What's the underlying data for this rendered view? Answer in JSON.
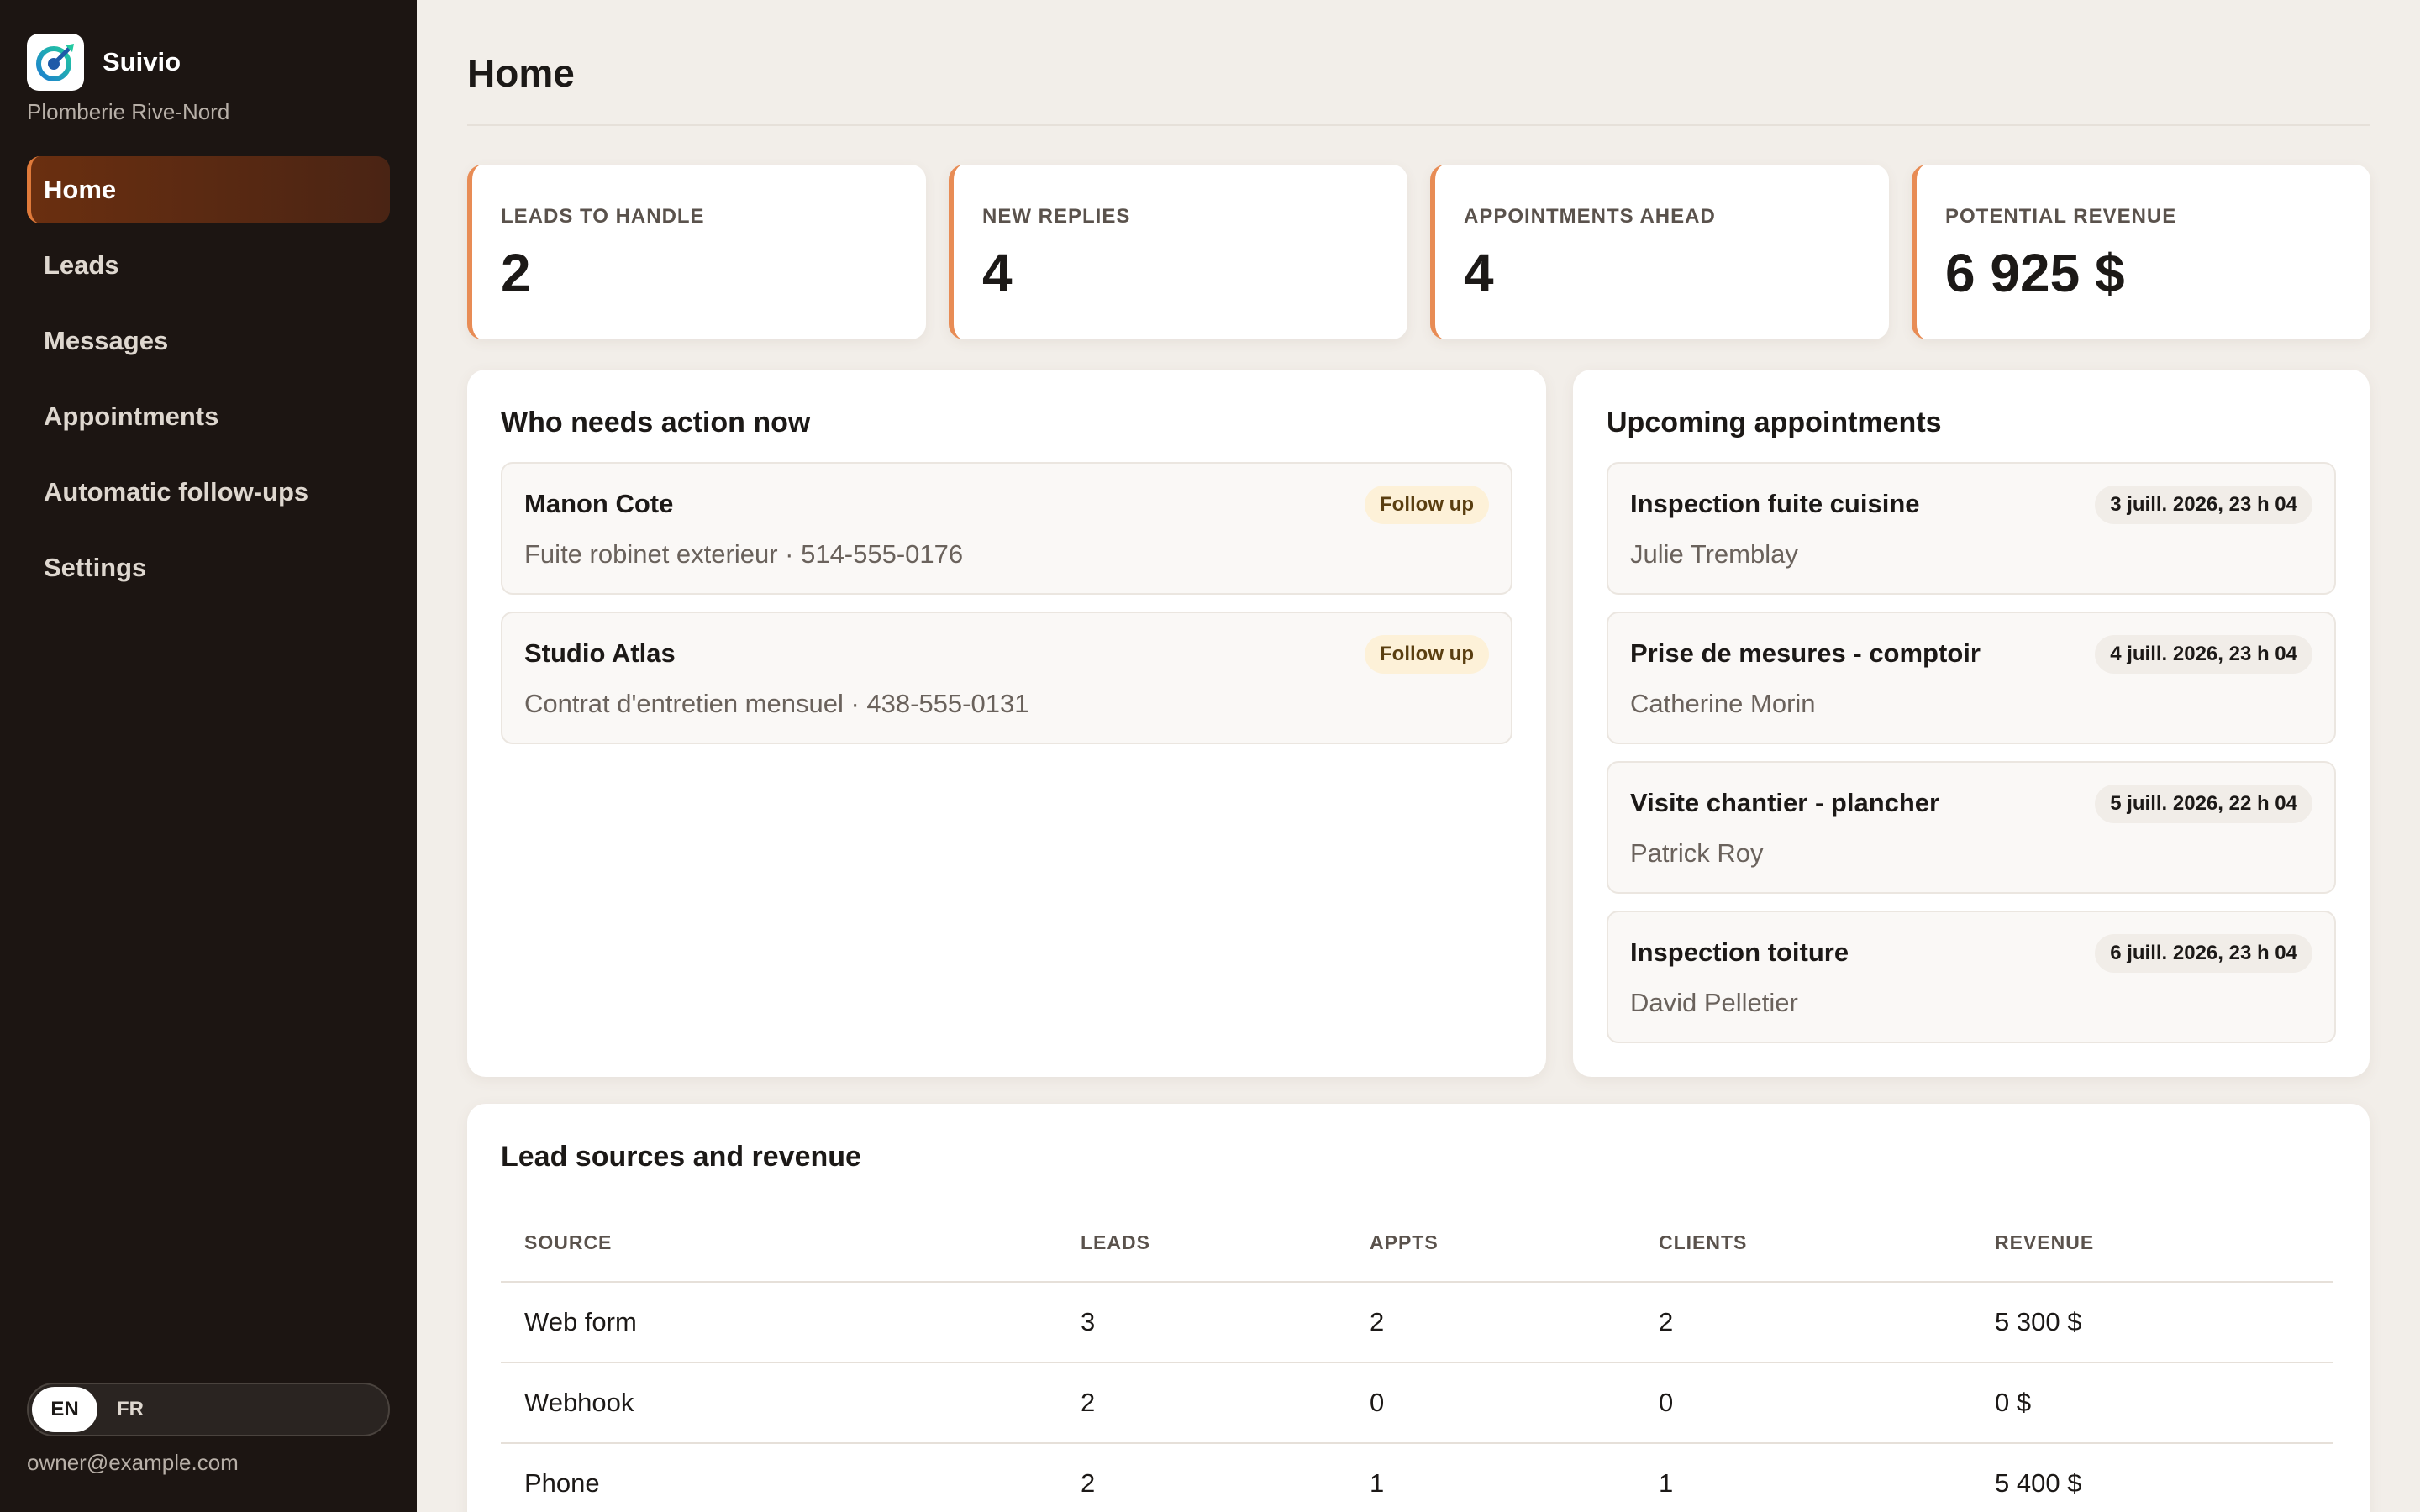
{
  "app": {
    "name": "Suivio",
    "company": "Plomberie Rive-Nord",
    "user_email": "owner@example.com",
    "accent_color": "#e88c55",
    "logo_icon": "target-arrow-icon"
  },
  "nav": {
    "items": [
      {
        "label": "Home",
        "active": true
      },
      {
        "label": "Leads",
        "active": false
      },
      {
        "label": "Messages",
        "active": false
      },
      {
        "label": "Appointments",
        "active": false
      },
      {
        "label": "Automatic follow-ups",
        "active": false
      },
      {
        "label": "Settings",
        "active": false
      }
    ]
  },
  "language": {
    "options": [
      "EN",
      "FR"
    ],
    "selected": "EN"
  },
  "page": {
    "title": "Home"
  },
  "kpis": [
    {
      "label": "LEADS TO HANDLE",
      "value": "2"
    },
    {
      "label": "NEW REPLIES",
      "value": "4"
    },
    {
      "label": "APPOINTMENTS AHEAD",
      "value": "4"
    },
    {
      "label": "POTENTIAL REVENUE",
      "value": "6 925 $"
    }
  ],
  "action": {
    "title": "Who needs action now",
    "items": [
      {
        "name": "Manon Cote",
        "detail": "Fuite robinet exterieur · 514-555-0176",
        "badge": "Follow up"
      },
      {
        "name": "Studio Atlas",
        "detail": "Contrat d'entretien mensuel · 438-555-0131",
        "badge": "Follow up"
      }
    ]
  },
  "appointments": {
    "title": "Upcoming appointments",
    "items": [
      {
        "title": "Inspection fuite cuisine",
        "person": "Julie Tremblay",
        "date": "3 juill. 2026, 23 h 04"
      },
      {
        "title": "Prise de mesures - comptoir",
        "person": "Catherine Morin",
        "date": "4 juill. 2026, 23 h 04"
      },
      {
        "title": "Visite chantier - plancher",
        "person": "Patrick Roy",
        "date": "5 juill. 2026, 22 h 04"
      },
      {
        "title": "Inspection toiture",
        "person": "David Pelletier",
        "date": "6 juill. 2026, 23 h 04"
      }
    ]
  },
  "sources": {
    "title": "Lead sources and revenue",
    "columns": [
      "SOURCE",
      "LEADS",
      "APPTS",
      "CLIENTS",
      "REVENUE"
    ],
    "rows": [
      [
        "Web form",
        "3",
        "2",
        "2",
        "5 300 $"
      ],
      [
        "Webhook",
        "2",
        "0",
        "0",
        "0 $"
      ],
      [
        "Phone",
        "2",
        "1",
        "1",
        "5 400 $"
      ]
    ]
  }
}
